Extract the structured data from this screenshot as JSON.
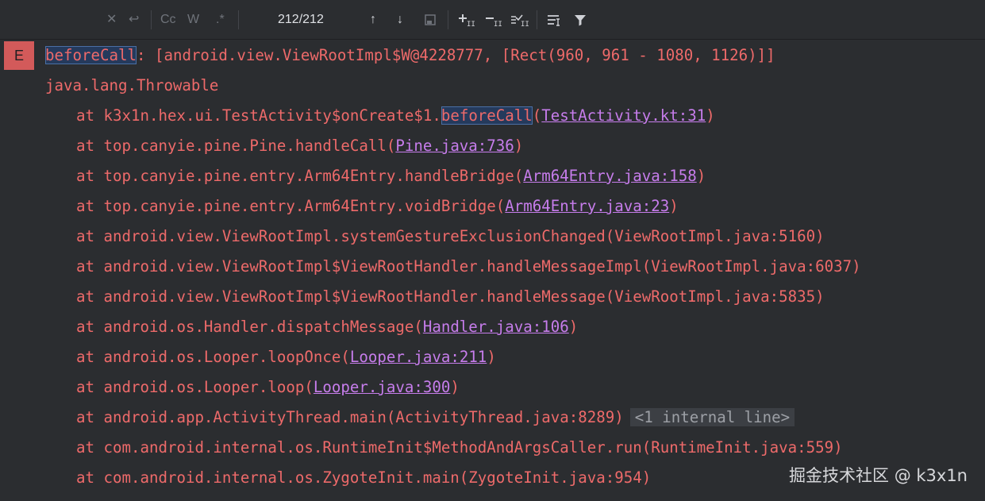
{
  "toolbar": {
    "search_value": "",
    "match_count": "212/212",
    "match_case_label": "Cc",
    "words_label": "W",
    "regex_label": ".*"
  },
  "log": {
    "level": "E",
    "header": {
      "highlight": "beforeCall",
      "rest": ": [android.view.ViewRootImpl$W@4228777, [Rect(960, 961 - 1080, 1126)]]"
    },
    "exception": "java.lang.Throwable",
    "frames": [
      {
        "prefix": "at k3x1n.hex.ui.TestActivity$onCreate$1.",
        "highlight": "beforeCall",
        "open": "(",
        "link": "TestActivity.kt:31",
        "close": ")"
      },
      {
        "prefix": "at top.canyie.pine.Pine.handleCall(",
        "link": "Pine.java:736",
        "close": ")"
      },
      {
        "prefix": "at top.canyie.pine.entry.Arm64Entry.handleBridge(",
        "link": "Arm64Entry.java:158",
        "close": ")"
      },
      {
        "prefix": "at top.canyie.pine.entry.Arm64Entry.voidBridge(",
        "link": "Arm64Entry.java:23",
        "close": ")"
      },
      {
        "text": "at android.view.ViewRootImpl.systemGestureExclusionChanged(ViewRootImpl.java:5160)"
      },
      {
        "text": "at android.view.ViewRootImpl$ViewRootHandler.handleMessageImpl(ViewRootImpl.java:6037)"
      },
      {
        "text": "at android.view.ViewRootImpl$ViewRootHandler.handleMessage(ViewRootImpl.java:5835)"
      },
      {
        "prefix": "at android.os.Handler.dispatchMessage(",
        "link": "Handler.java:106",
        "close": ")"
      },
      {
        "prefix": "at android.os.Looper.loopOnce(",
        "link": "Looper.java:211",
        "close": ")"
      },
      {
        "prefix": "at android.os.Looper.loop(",
        "link": "Looper.java:300",
        "close": ")"
      },
      {
        "text": "at android.app.ActivityThread.main(ActivityThread.java:8289)",
        "fold": "<1 internal line>"
      },
      {
        "text": "at com.android.internal.os.RuntimeInit$MethodAndArgsCaller.run(RuntimeInit.java:559)"
      },
      {
        "text": "at com.android.internal.os.ZygoteInit.main(ZygoteInit.java:954)"
      }
    ]
  },
  "watermark": "掘金技术社区 @ k3x1n",
  "colors": {
    "background": "#2b2d30",
    "error_text": "#ee6a6a",
    "level_badge": "#d35a5a",
    "link": "#c77dec",
    "highlight_bg": "#253a5c"
  }
}
